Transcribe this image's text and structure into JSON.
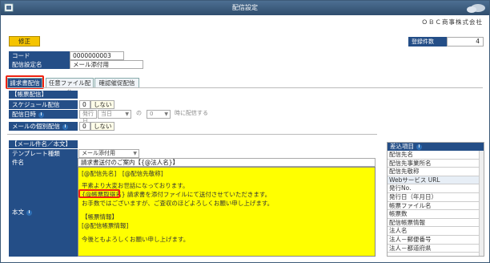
{
  "window": {
    "title": "配信設定"
  },
  "company": "ＯＢＣ商事株式会社",
  "edit_button": "修正",
  "registered_count": {
    "label": "登録件数",
    "value": "4"
  },
  "code": {
    "label": "コード",
    "value": "0000000003"
  },
  "setting_name": {
    "label": "配信設定名",
    "value": "メール添付用"
  },
  "tabs": [
    "請求書配信",
    "任意ファイル配信",
    "確認催促配信"
  ],
  "form_delivery": {
    "section": "【帳票配信】",
    "schedule_label": "スケジュール配信",
    "schedule_value": "0",
    "schedule_text": "しない",
    "datetime_label": "配信日時",
    "datetime_part1": "発行日",
    "datetime_part2": "当日",
    "datetime_part3": "の",
    "datetime_part4": "0",
    "datetime_part5": "時に配信する",
    "individual_label": "メールの個別配信",
    "individual_value": "0",
    "individual_text": "しない"
  },
  "mail": {
    "section": "【メール件名／本文】",
    "template_label": "テンプレート種類",
    "template_value": "メール添付用",
    "subject_label": "件名",
    "subject_value": "請求書送付のご案内【{@法人名}】",
    "body_label": "本文",
    "body_lines": [
      "[@配信先名]　[@配信先敬称]",
      "",
      "平素より大変お世話になっております。",
      "{@帳票取得名} 請求書を添付ファイルにて送付させていただきます。",
      "お手数ではございますが、ご査収のほどよろしくお願い申し上げます。",
      "",
      "【帳票情報】",
      "[@配信帳票情報]",
      "",
      "今後ともよろしくお願い申し上げます。"
    ]
  },
  "insert_panel": {
    "title": "差込項目",
    "items": [
      "配信先名",
      "配信先事業所名",
      "配信先敬称",
      "Webサービス URL",
      "発行No.",
      "発行日（年月日）",
      "帳票ファイル名",
      "帳票数",
      "配信帳票情報",
      "法人名",
      "法人－郵便番号",
      "法人－都道府県"
    ]
  }
}
